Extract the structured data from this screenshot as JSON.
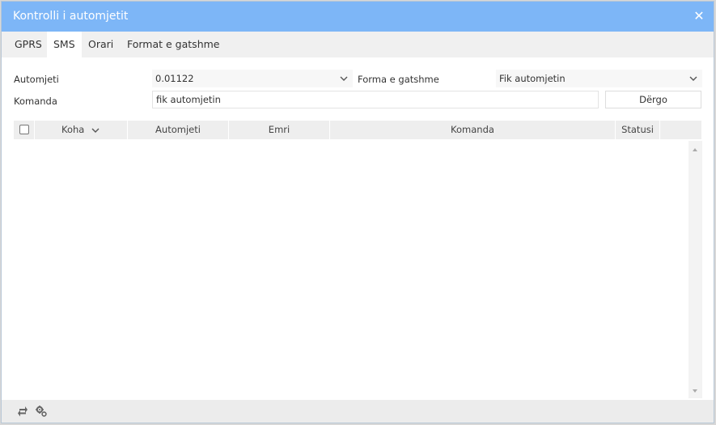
{
  "window": {
    "title": "Kontrolli i automjetit"
  },
  "tabs": [
    {
      "label": "GPRS"
    },
    {
      "label": "SMS"
    },
    {
      "label": "Orari"
    },
    {
      "label": "Format e gatshme"
    }
  ],
  "form": {
    "vehicle_label": "Automjeti",
    "vehicle_value": "0.01122",
    "template_label": "Forma e gatshme",
    "template_value": "Fik automjetin",
    "command_label": "Komanda",
    "command_value": "fik automjetin",
    "send_label": "Dërgo"
  },
  "grid": {
    "columns": [
      {
        "label": "Koha"
      },
      {
        "label": "Automjeti"
      },
      {
        "label": "Emri"
      },
      {
        "label": "Komanda"
      },
      {
        "label": "Statusi"
      }
    ],
    "rows": []
  },
  "icons": {
    "close": "close-icon",
    "refresh": "refresh-icon",
    "settings": "settings-gear-icon",
    "sort": "chevron-down-icon"
  },
  "colors": {
    "titlebar": "#7db6f7",
    "tabbar": "#f0f0f0",
    "grid_header": "#eeeeee"
  }
}
